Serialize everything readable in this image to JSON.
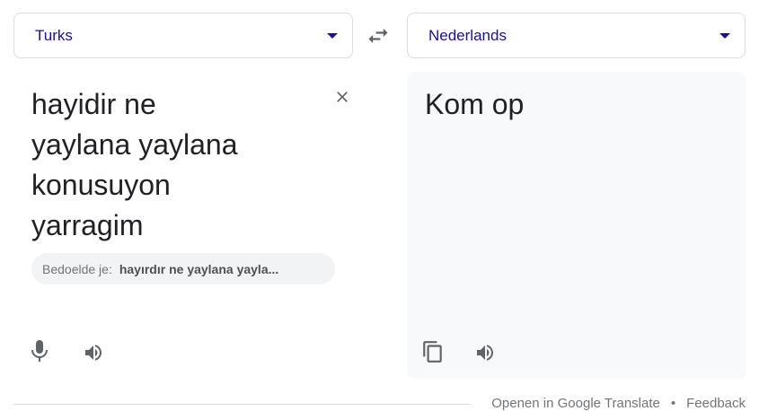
{
  "source_language": {
    "label": "Turks"
  },
  "target_language": {
    "label": "Nederlands"
  },
  "source": {
    "text": "hayidir ne\nyaylana yaylana\nkonusuyon\nyarragim",
    "did_you_mean_prefix": "Bedoelde je:",
    "did_you_mean_suggestion": "hayırdır ne yaylana yayla..."
  },
  "target": {
    "text": "Kom op"
  },
  "footer": {
    "open_link": "Openen in Google Translate",
    "separator": "•",
    "feedback_link": "Feedback"
  },
  "icons": {
    "swap": "swap-icon",
    "clear": "close-icon",
    "mic": "microphone-icon",
    "speaker": "speaker-icon",
    "copy": "copy-icon",
    "caret": "triangle-down-icon"
  },
  "colors": {
    "language_label": "#1a0dab",
    "icon_gray": "#5f6368",
    "target_bg": "#f8f9fa",
    "suggestion_bg": "#f1f3f4"
  }
}
